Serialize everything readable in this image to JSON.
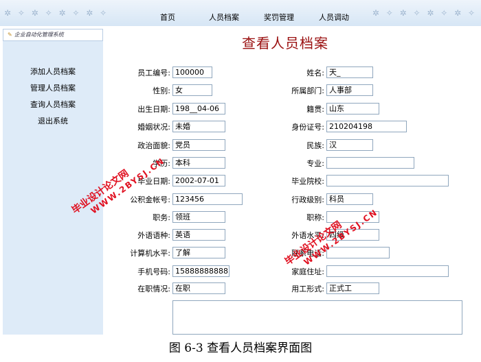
{
  "nav": {
    "items": [
      "首页",
      "人员档案",
      "奖罚管理",
      "人员调动"
    ]
  },
  "sidebar": {
    "title": "企业自动化管理系统",
    "items": [
      "添加人员档案",
      "管理人员档案",
      "查询人员档案",
      "退出系统"
    ]
  },
  "page": {
    "title": "查看人员档案"
  },
  "form": {
    "left": [
      {
        "label": "员工编号:",
        "value": "100000"
      },
      {
        "label": "性别:",
        "value": "女"
      },
      {
        "label": "出生日期:",
        "value": "198__04-06"
      },
      {
        "label": "婚姻状况:",
        "value": "未婚"
      },
      {
        "label": "政治面貌:",
        "value": "党员"
      },
      {
        "label": "学历:",
        "value": "本科"
      },
      {
        "label": "毕业日期:",
        "value": "2002-07-01"
      },
      {
        "label": "公积金帐号:",
        "value": "123456"
      },
      {
        "label": "职务:",
        "value": "领班"
      },
      {
        "label": "外语语种:",
        "value": "英语"
      },
      {
        "label": "计算机水平:",
        "value": "了解"
      },
      {
        "label": "手机号码:",
        "value": "15888888888"
      },
      {
        "label": "在职情况:",
        "value": "在职"
      }
    ],
    "right": [
      {
        "label": "姓名:",
        "value": "天_"
      },
      {
        "label": "所属部门:",
        "value": "人事部"
      },
      {
        "label": "籍贯:",
        "value": "山东"
      },
      {
        "label": "身份证号:",
        "value": "210204198"
      },
      {
        "label": "民族:",
        "value": "汉"
      },
      {
        "label": "专业:",
        "value": ""
      },
      {
        "label": "毕业院校:",
        "value": ""
      },
      {
        "label": "行政级别:",
        "value": "科员"
      },
      {
        "label": "职称:",
        "value": ""
      },
      {
        "label": "外语水平:",
        "value": "四级"
      },
      {
        "label": "联系电话:",
        "value": ""
      },
      {
        "label": "家庭住址:",
        "value": ""
      },
      {
        "label": "用工形式:",
        "value": "正式工"
      }
    ]
  },
  "watermarks": [
    {
      "main": "毕业设计论文网",
      "url": "WWW.2BYSJ.CN"
    },
    {
      "main": "毕业设计论文网",
      "url": "WWW.2BYSJ.CN"
    }
  ],
  "caption": "图 6-3  查看人员档案界面图"
}
